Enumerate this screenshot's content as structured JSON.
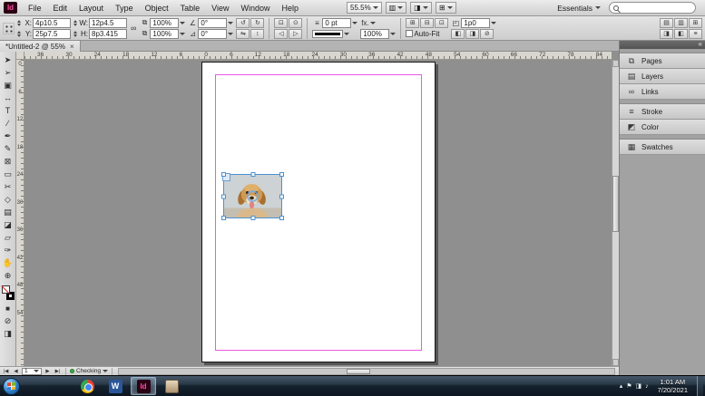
{
  "colors": {
    "accent_blue": "#4d90d0",
    "margin_guide": "#e85ae8",
    "preflight_green": "#3fae49",
    "indesign_brand_bg": "#2a0113",
    "indesign_brand_pink": "#ff4fa3"
  },
  "menubar": {
    "app_initials": "Id",
    "menus": [
      "File",
      "Edit",
      "Layout",
      "Type",
      "Object",
      "Table",
      "View",
      "Window",
      "Help"
    ],
    "zoom_value": "55.5%",
    "workspace": "Essentials",
    "view_controls": [
      {
        "name": "view-options",
        "glyph": "▥"
      },
      {
        "name": "screen-mode",
        "glyph": "◨"
      },
      {
        "name": "arrange-documents",
        "glyph": "⊞"
      }
    ]
  },
  "control": {
    "x_label": "X:",
    "x_value": "4p10.5",
    "y_label": "Y:",
    "y_value": "25p7.5",
    "w_label": "W:",
    "w_value": "12p4.5",
    "h_label": "H:",
    "h_value": "8p3.415",
    "scale_x": "100%",
    "scale_y": "100%",
    "rotation_angle": "0°",
    "shear_angle": "0°",
    "stroke_weight": "0 pt",
    "fx_label": "fx.",
    "opacity": "100%",
    "corner_radius": "1p0",
    "autofit_label": "Auto-Fit"
  },
  "glyphs": {
    "chain": "∞",
    "scale": "⧉",
    "rotation": "∠",
    "shear": "⊿",
    "rotate_cw": "↻",
    "rotate_ccw": "↺",
    "flip_h": "⇋",
    "flip_v": "↕",
    "select_container": "⊡",
    "select_content": "⊙",
    "prev_object": "◁",
    "next_object": "▷",
    "stroke_weight_icon": "≡",
    "fit_content": "⊞",
    "fit_frame": "⊟",
    "center_content": "⊡",
    "corner_icon": "◰",
    "wrap_none": "◧",
    "wrap_bound": "◨",
    "wrap_jump": "⊘",
    "align_icon": "▤",
    "distribute_icon": "▥",
    "object_styles_icon": "⊞",
    "panel_menu": "≡",
    "up_arrow": "▴"
  },
  "doc": {
    "tab_title": "*Untitled-2 @ 55%",
    "close_glyph": "×"
  },
  "rulers": {
    "horizontal": [
      "36",
      "30",
      "24",
      "18",
      "12",
      "6",
      "0",
      "6",
      "12",
      "18",
      "24",
      "30",
      "36",
      "42",
      "48",
      "54",
      "60",
      "66",
      "72",
      "78",
      "84"
    ],
    "vertical": [
      "0",
      "6",
      "12",
      "18",
      "24",
      "30",
      "36",
      "42",
      "48",
      "54"
    ]
  },
  "tools": [
    {
      "name": "selection-tool",
      "glyph": "➤"
    },
    {
      "name": "direct-selection-tool",
      "glyph": "➢"
    },
    {
      "name": "page-tool",
      "glyph": "▣"
    },
    {
      "name": "gap-tool",
      "glyph": "↔"
    },
    {
      "name": "type-tool",
      "glyph": "T"
    },
    {
      "name": "line-tool",
      "glyph": "∕"
    },
    {
      "name": "pen-tool",
      "glyph": "✒"
    },
    {
      "name": "pencil-tool",
      "glyph": "✎"
    },
    {
      "name": "rectangle-frame-tool",
      "glyph": "⊠"
    },
    {
      "name": "rectangle-tool",
      "glyph": "▭"
    },
    {
      "name": "scissors-tool",
      "glyph": "✂"
    },
    {
      "name": "free-transform-tool",
      "glyph": "◇"
    },
    {
      "name": "gradient-swatch-tool",
      "glyph": "▤"
    },
    {
      "name": "gradient-feather-tool",
      "glyph": "◪"
    },
    {
      "name": "note-tool",
      "glyph": "▱"
    },
    {
      "name": "eyedropper-tool",
      "glyph": "✑"
    },
    {
      "name": "hand-tool",
      "glyph": "✋"
    },
    {
      "name": "zoom-tool",
      "glyph": "⊕"
    }
  ],
  "dock": {
    "expand_glyph": "«",
    "panels": [
      {
        "label": "Pages",
        "glyph": "⧉"
      },
      {
        "label": "Layers",
        "glyph": "▤"
      },
      {
        "label": "Links",
        "glyph": "∞"
      },
      {
        "label": "Stroke",
        "glyph": "≡"
      },
      {
        "label": "Color",
        "glyph": "◩"
      },
      {
        "label": "Swatches",
        "glyph": "▦"
      }
    ]
  },
  "statusbar": {
    "nav_first": "|◀",
    "nav_prev": "◀",
    "page_value": "1",
    "nav_next": "▶",
    "nav_last": "▶|",
    "preflight_label": "Checking"
  },
  "taskbar": {
    "apps": [
      {
        "name": "chrome"
      },
      {
        "name": "word",
        "initial": "W"
      },
      {
        "name": "indesign",
        "initial": "Id"
      },
      {
        "name": "app4"
      }
    ],
    "tray_icons": [
      {
        "name": "show-hidden-icons",
        "glyph": "▴"
      },
      {
        "name": "action-center-icon",
        "glyph": "⚑"
      },
      {
        "name": "network-icon",
        "glyph": "◨"
      },
      {
        "name": "volume-icon",
        "glyph": "♪"
      }
    ],
    "time": "1:01 AM",
    "date": "7/20/2021"
  }
}
